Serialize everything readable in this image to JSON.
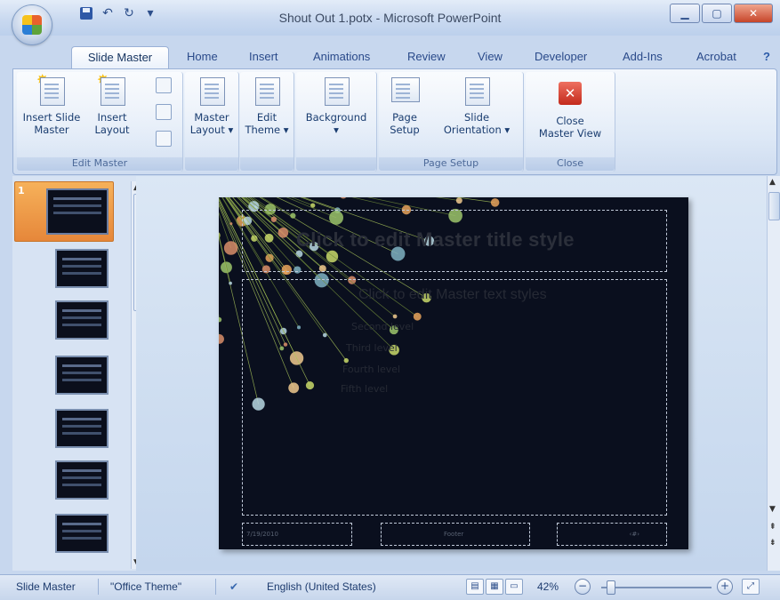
{
  "window": {
    "title": "Shout Out 1.potx - Microsoft PowerPoint",
    "minimize_icon": "minimize-icon",
    "maximize_icon": "maximize-icon",
    "close_icon": "close-icon"
  },
  "qat": {
    "save": "save-icon",
    "undo": "↶",
    "redo": "↻",
    "customize": "▾"
  },
  "tabs": [
    "Slide Master",
    "Home",
    "Insert",
    "Animations",
    "Review",
    "View",
    "Developer",
    "Add-Ins",
    "Acrobat"
  ],
  "ribbon": {
    "edit_master": {
      "label": "Edit Master",
      "insert_slide_master": [
        "Insert Slide",
        "Master"
      ],
      "insert_layout": [
        "Insert",
        "Layout"
      ]
    },
    "master_layout": {
      "label": [
        "Master",
        "Layout ▾"
      ]
    },
    "edit_theme": {
      "label": [
        "Edit",
        "Theme ▾"
      ]
    },
    "background": {
      "label": "Background",
      "arrow": "▾"
    },
    "page_setup": {
      "label": "Page Setup",
      "page_setup": [
        "Page",
        "Setup"
      ],
      "slide_orientation": [
        "Slide",
        "Orientation ▾"
      ]
    },
    "close": {
      "label": "Close",
      "close_master_view": [
        "Close",
        "Master View"
      ],
      "icon_glyph": "✕"
    }
  },
  "pane": {
    "selected_number": "1"
  },
  "slide": {
    "title": "Click to edit Master title style",
    "body_lvl1": "Click to edit Master text styles",
    "body_levels": [
      "Second level",
      "Third level",
      "Fourth level",
      "Fifth level"
    ],
    "footer_date": "7/19/2010",
    "footer_center": "Footer",
    "footer_number": "‹#›"
  },
  "status": {
    "view": "Slide Master",
    "theme": "\"Office Theme\"",
    "language": "English (United States)",
    "zoom": "42%",
    "zoom_minus": "−",
    "zoom_plus": "+"
  }
}
